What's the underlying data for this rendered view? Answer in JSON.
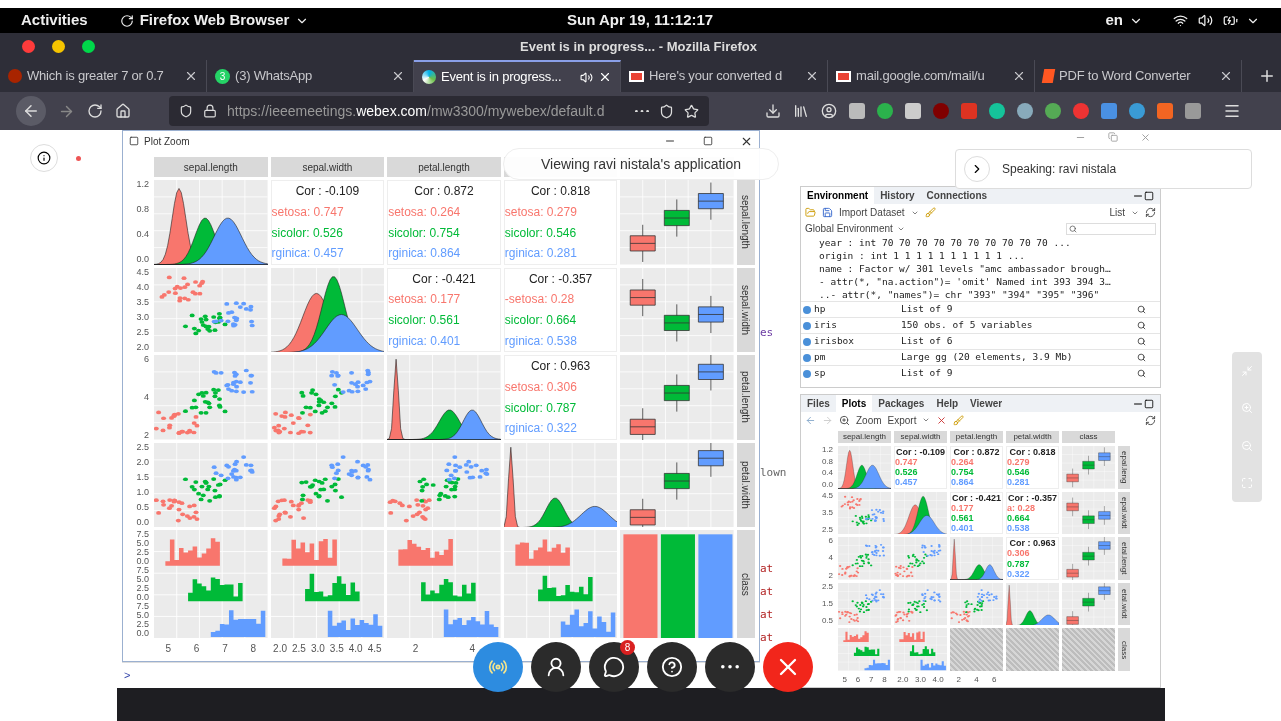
{
  "topbar": {
    "activities": "Activities",
    "app": "Firefox Web Browser",
    "clock": "Sun Apr 19, 11:12:17",
    "lang": "en"
  },
  "window": {
    "title": "Event is in progress... - Mozilla Firefox"
  },
  "tabs": [
    {
      "label": "Which is greater 7 or 0.7",
      "kind": "quora",
      "selected": false
    },
    {
      "label": "(3) WhatsApp",
      "kind": "whatsapp",
      "badge": "3",
      "selected": false
    },
    {
      "label": "Event is in progress...",
      "kind": "webex",
      "selected": true
    },
    {
      "label": "Here's your converted d",
      "kind": "mail",
      "selected": false
    },
    {
      "label": "mail.google.com/mail/u",
      "kind": "mail",
      "selected": false
    },
    {
      "label": "PDF to Word Converter",
      "kind": "pdf",
      "selected": false
    }
  ],
  "url": {
    "prefix": "https://ieeemeetings.",
    "host": "webex.com",
    "path": "/mw3300/mywebex/default.d"
  },
  "plot_window": {
    "title": "Plot Zoom"
  },
  "big_plot": {
    "headers": [
      "sepal.length",
      "sepal.width",
      "petal.length"
    ],
    "rows": [
      {
        "strip": "sepal.length",
        "yticks": [
          "1.2",
          "0.8",
          "0.4",
          "0.0"
        ],
        "cells": [
          {
            "kind": "density"
          },
          {
            "kind": "cor",
            "cor": "Cor : -0.109",
            "groups": [
              {
                "label": "setosa: 0.747",
                "color": "#f8766d"
              },
              {
                "label": "sicolor: 0.526",
                "color": "#00ba38"
              },
              {
                "label": "rginica: 0.457",
                "color": "#619cff"
              }
            ]
          },
          {
            "kind": "cor",
            "cor": "Cor : 0.872",
            "groups": [
              {
                "label": "setosa: 0.264",
                "color": "#f8766d"
              },
              {
                "label": "sicolor: 0.754",
                "color": "#00ba38"
              },
              {
                "label": "rginica: 0.864",
                "color": "#619cff"
              }
            ]
          },
          {
            "kind": "cor",
            "cor": "Cor : 0.818",
            "groups": [
              {
                "label": "setosa: 0.279",
                "color": "#f8766d"
              },
              {
                "label": "sicolor: 0.546",
                "color": "#00ba38"
              },
              {
                "label": "rginica: 0.281",
                "color": "#619cff"
              }
            ]
          },
          {
            "kind": "box"
          }
        ]
      },
      {
        "strip": "sepal.width",
        "yticks": [
          "4.5",
          "4.0",
          "3.5",
          "3.0",
          "2.5",
          "2.0"
        ],
        "cells": [
          {
            "kind": "scatter"
          },
          {
            "kind": "density"
          },
          {
            "kind": "cor",
            "cor": "Cor : -0.421",
            "groups": [
              {
                "label": "setosa: 0.177",
                "color": "#f8766d"
              },
              {
                "label": "sicolor: 0.561",
                "color": "#00ba38"
              },
              {
                "label": "rginica: 0.401",
                "color": "#619cff"
              }
            ]
          },
          {
            "kind": "cor",
            "cor": "Cor : -0.357",
            "groups": [
              {
                "label": "-setosa: 0.28",
                "color": "#f8766d"
              },
              {
                "label": "sicolor: 0.664",
                "color": "#00ba38"
              },
              {
                "label": "rginica: 0.538",
                "color": "#619cff"
              }
            ]
          },
          {
            "kind": "box"
          }
        ]
      },
      {
        "strip": "petal.length",
        "yticks": [
          "6",
          "4",
          "2"
        ],
        "cells": [
          {
            "kind": "scatter"
          },
          {
            "kind": "scatter"
          },
          {
            "kind": "density"
          },
          {
            "kind": "cor",
            "cor": "Cor : 0.963",
            "groups": [
              {
                "label": "setosa: 0.306",
                "color": "#f8766d"
              },
              {
                "label": "sicolor: 0.787",
                "color": "#00ba38"
              },
              {
                "label": "rginica: 0.322",
                "color": "#619cff"
              }
            ]
          },
          {
            "kind": "box"
          }
        ]
      },
      {
        "strip": "petal.width",
        "yticks": [
          "2.5",
          "2.0",
          "1.5",
          "1.0",
          "0.5",
          "0.0"
        ],
        "cells": [
          {
            "kind": "scatter"
          },
          {
            "kind": "scatter"
          },
          {
            "kind": "scatter"
          },
          {
            "kind": "density"
          },
          {
            "kind": "box"
          }
        ]
      },
      {
        "strip": "class",
        "yticks": [
          "7.5",
          "5.0",
          "2.5",
          "0.0",
          "7.5",
          "5.0",
          "2.5",
          "0.0",
          "7.5",
          "5.0",
          "2.5",
          "0.0"
        ],
        "cells": [
          {
            "kind": "hist"
          },
          {
            "kind": "hist"
          },
          {
            "kind": "hist"
          },
          {
            "kind": "hist"
          },
          {
            "kind": "bars"
          }
        ]
      }
    ],
    "xticks": [
      [
        "5",
        "6",
        "7",
        "8"
      ],
      [
        "2.0",
        "2.5",
        "3.0",
        "3.5",
        "4.0",
        "4.5"
      ],
      [
        "2",
        "4"
      ]
    ]
  },
  "console_prompt": ">",
  "source_fragments": [
    {
      "text": "es",
      "kind": "keyword"
    },
    {
      "text": "lown",
      "kind": "plain"
    },
    {
      "text": "at",
      "kind": "string"
    },
    {
      "text": "at",
      "kind": "string"
    },
    {
      "text": "at",
      "kind": "string"
    },
    {
      "text": "at",
      "kind": "string"
    }
  ],
  "environment": {
    "tabs": [
      {
        "label": "Environment",
        "selected": true
      },
      {
        "label": "History",
        "selected": false
      },
      {
        "label": "Connections",
        "selected": false
      }
    ],
    "import": "Import Dataset",
    "view": "List",
    "scope": "Global Environment",
    "lines": [
      "year : int 70 70 70 70 70 70 70 70 70 70 ...",
      "origin : int 1 1 1 1 1 1 1 1 1 1 ...",
      "name : Factor w/ 301 levels \"amc ambassador brough…",
      "- attr(*, \"na.action\")= 'omit' Named int 393 394 3…",
      "..- attr(*, \"names\")= chr \"393\" \"394\" \"395\" \"396\""
    ],
    "objects": [
      {
        "name": "hp",
        "value": "List of 9"
      },
      {
        "name": "iris",
        "value": "150 obs. of 5 variables"
      },
      {
        "name": "irisbox",
        "value": "List of 6"
      },
      {
        "name": "pm",
        "value": "Large gg (20 elements, 3.9 Mb)"
      },
      {
        "name": "sp",
        "value": "List of 9"
      }
    ]
  },
  "plots_pane": {
    "tabs": [
      {
        "label": "Files",
        "selected": false
      },
      {
        "label": "Plots",
        "selected": true
      },
      {
        "label": "Packages",
        "selected": false
      },
      {
        "label": "Help",
        "selected": false
      },
      {
        "label": "Viewer",
        "selected": false
      }
    ],
    "zoom": "Zoom",
    "export": "Export"
  },
  "small_plot": {
    "headers": [
      "sepal.length",
      "sepal.width",
      "petal.length",
      "petal.width",
      "class"
    ],
    "rows": [
      {
        "strip": "epal.leng",
        "yticks": [
          "1.2",
          "0.8",
          "0.4",
          "0.0"
        ],
        "cells": [
          {
            "kind": "density"
          },
          {
            "kind": "cor",
            "cor": "Cor : -0.109",
            "groups": [
              {
                "label": "0.747",
                "color": "#f8766d"
              },
              {
                "label": "0.526",
                "color": "#00ba38"
              },
              {
                "label": "0.457",
                "color": "#619cff"
              }
            ]
          },
          {
            "kind": "cor",
            "cor": "Cor : 0.872",
            "groups": [
              {
                "label": "0.264",
                "color": "#f8766d"
              },
              {
                "label": "0.754",
                "color": "#00ba38"
              },
              {
                "label": "0.864",
                "color": "#619cff"
              }
            ]
          },
          {
            "kind": "cor",
            "cor": "Cor : 0.818",
            "groups": [
              {
                "label": "0.279",
                "color": "#f8766d"
              },
              {
                "label": "0.546",
                "color": "#00ba38"
              },
              {
                "label": "0.281",
                "color": "#619cff"
              }
            ]
          },
          {
            "kind": "box"
          }
        ]
      },
      {
        "strip": "epal.widt",
        "yticks": [
          "4.5",
          "3.5",
          "2.5"
        ],
        "cells": [
          {
            "kind": "scatter"
          },
          {
            "kind": "density"
          },
          {
            "kind": "cor",
            "cor": "Cor : -0.421",
            "groups": [
              {
                "label": "0.177",
                "color": "#f8766d"
              },
              {
                "label": "0.561",
                "color": "#00ba38"
              },
              {
                "label": "0.401",
                "color": "#619cff"
              }
            ]
          },
          {
            "kind": "cor",
            "cor": "Cor : -0.357",
            "groups": [
              {
                "label": "a: 0.28",
                "color": "#f8766d"
              },
              {
                "label": "0.664",
                "color": "#00ba38"
              },
              {
                "label": "0.538",
                "color": "#619cff"
              }
            ]
          },
          {
            "kind": "box"
          }
        ]
      },
      {
        "strip": "etal.lengt",
        "yticks": [
          "6",
          "4",
          "2"
        ],
        "cells": [
          {
            "kind": "scatter"
          },
          {
            "kind": "scatter"
          },
          {
            "kind": "density"
          },
          {
            "kind": "cor",
            "cor": "Cor : 0.963",
            "groups": [
              {
                "label": "0.306",
                "color": "#f8766d"
              },
              {
                "label": "0.787",
                "color": "#00ba38"
              },
              {
                "label": "0.322",
                "color": "#619cff"
              }
            ]
          },
          {
            "kind": "box"
          }
        ]
      },
      {
        "strip": "etal.widt",
        "yticks": [
          "2.5",
          "1.5",
          "0.5"
        ],
        "cells": [
          {
            "kind": "scatter"
          },
          {
            "kind": "scatter"
          },
          {
            "kind": "scatter"
          },
          {
            "kind": "density"
          },
          {
            "kind": "box"
          }
        ]
      },
      {
        "strip": "class",
        "yticks": [],
        "cells": [
          {
            "kind": "hist"
          },
          {
            "kind": "hist"
          },
          {
            "kind": "checker"
          },
          {
            "kind": "checker"
          },
          {
            "kind": "checker"
          }
        ]
      }
    ],
    "xticks": [
      [
        "5",
        "6",
        "7",
        "8"
      ],
      [
        "2.0",
        "3.0",
        "4.0"
      ],
      [
        "2",
        "4",
        "6"
      ]
    ]
  },
  "share": {
    "viewing": "Viewing ravi nistala's application",
    "speaking": "Speaking: ravi nistala"
  },
  "controls": [
    {
      "kind": "audio"
    },
    {
      "kind": "participants"
    },
    {
      "kind": "chat",
      "badge": "8"
    },
    {
      "kind": "qa"
    },
    {
      "kind": "more"
    },
    {
      "kind": "leave"
    }
  ]
}
